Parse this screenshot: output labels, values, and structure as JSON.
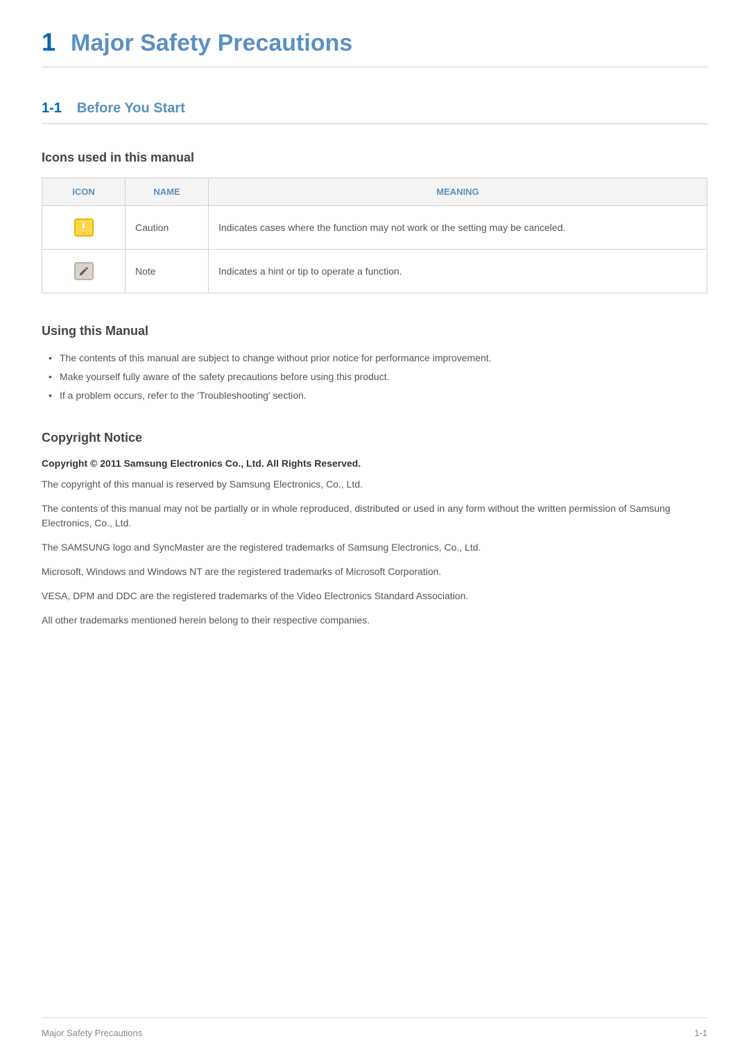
{
  "chapter": {
    "number": "1",
    "title": "Major Safety Precautions"
  },
  "section": {
    "number": "1-1",
    "title": "Before You Start"
  },
  "icons_section": {
    "heading": "Icons used in this manual",
    "headers": {
      "icon": "ICON",
      "name": "NAME",
      "meaning": "MEANING"
    },
    "rows": [
      {
        "icon_name": "caution-icon",
        "name": "Caution",
        "meaning": "Indicates cases where the function may not work or the setting may be canceled."
      },
      {
        "icon_name": "note-icon",
        "name": "Note",
        "meaning": "Indicates a hint or tip to operate a function."
      }
    ]
  },
  "using_manual": {
    "heading": "Using this Manual",
    "bullets": [
      "The contents of this manual are subject to change without prior notice for performance improvement.",
      "Make yourself fully aware of the safety precautions before using this product.",
      "If a problem occurs, refer to the 'Troubleshooting' section."
    ]
  },
  "copyright": {
    "heading": "Copyright Notice",
    "bold_line": "Copyright © 2011 Samsung Electronics Co., Ltd. All Rights Reserved.",
    "paragraphs": [
      "The copyright of this manual is reserved by Samsung Electronics, Co., Ltd.",
      "The contents of this manual may not be partially or in whole reproduced, distributed or used in any form without the written permission of Samsung Electronics, Co., Ltd.",
      "The SAMSUNG logo and SyncMaster are the registered trademarks of Samsung Electronics, Co., Ltd.",
      "Microsoft, Windows and Windows NT are the registered trademarks of Microsoft Corporation.",
      "VESA, DPM and DDC are the registered trademarks of the Video Electronics Standard Association.",
      "All other trademarks mentioned herein belong to their respective companies."
    ]
  },
  "footer": {
    "left": "Major Safety Precautions",
    "right": "1-1"
  }
}
